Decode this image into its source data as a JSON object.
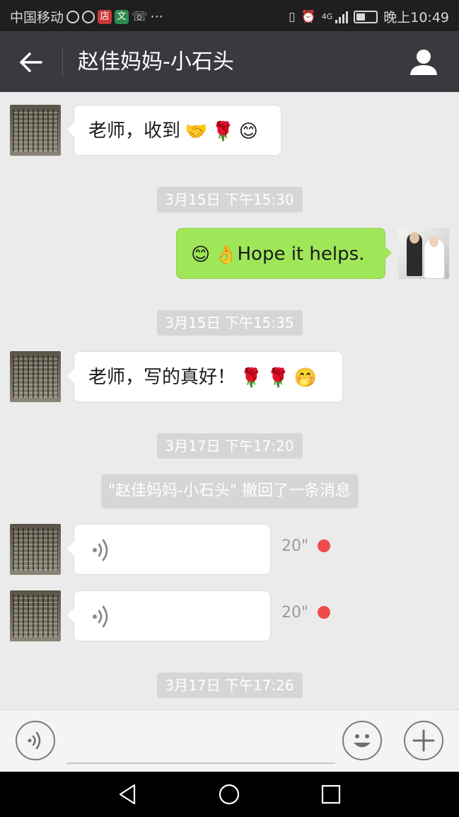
{
  "status_bar": {
    "carrier": "中国移动",
    "icon_dian": "店",
    "icon_wen": "文",
    "more": "···",
    "network": "4G",
    "time": "晚上10:49"
  },
  "header": {
    "title": "赵佳妈妈-小石头"
  },
  "messages": {
    "m1": {
      "text": "老师，收到",
      "emoji": [
        "🤝",
        "🌹",
        "😊"
      ]
    },
    "t1": "3月15日 下午15:30",
    "m2": {
      "text": "Hope it helps.",
      "emoji": [
        "😊",
        "👌"
      ]
    },
    "t2": "3月15日 下午15:35",
    "m3": {
      "text": "老师，写的真好！",
      "emoji": [
        "🌹",
        "🌹",
        "🤭"
      ]
    },
    "t3": "3月17日 下午17:20",
    "recall": "\"赵佳妈妈-小石头\" 撤回了一条消息",
    "v1": {
      "duration": "20\""
    },
    "v2": {
      "duration": "20\""
    },
    "t4": "3月17日 下午17:26"
  },
  "input_bar": {
    "placeholder": ""
  },
  "colors": {
    "status_bg": "#1f1f1f",
    "title_bg": "#393a3f",
    "chat_bg": "#ebebeb",
    "sent_bubble": "#9fe658",
    "unread_dot": "#f04b4b"
  }
}
